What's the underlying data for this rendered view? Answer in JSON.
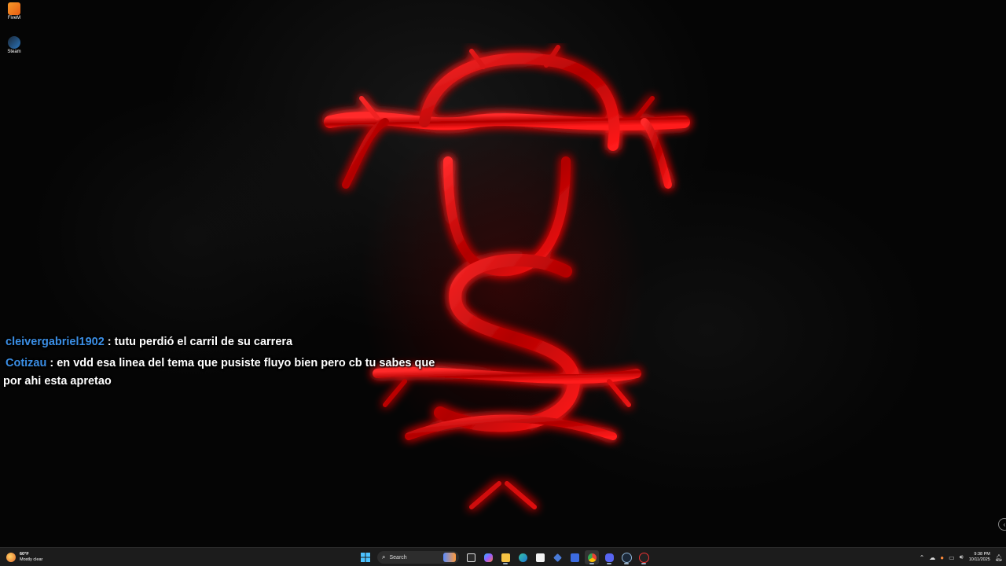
{
  "desktop": {
    "icons": [
      {
        "label": "FiveM",
        "icon": "fivem-icon"
      },
      {
        "label": "Steam",
        "icon": "steam-icon"
      }
    ],
    "wallpaper": {
      "icon": "gothic-monogram-logo",
      "glow_color": "#d10000"
    }
  },
  "chat": {
    "user_color": "#3b8fe6",
    "messages": [
      {
        "user": "cleivergabriel1902",
        "text": " : tutu perdió el carril de su carrera"
      },
      {
        "user": "Cotizau",
        "text": " : en vdd esa linea del tema que pusiste fluyo bien pero cb tu sabes que por ahi esta apretao"
      }
    ]
  },
  "taskbar": {
    "weather": {
      "temp": "60°F",
      "condition": "Mostly clear",
      "icon": "sun-moon-icon"
    },
    "search_placeholder": "Search",
    "apps": [
      "start-icon",
      "search",
      "task-view-icon",
      "copilot-icon",
      "file-explorer-icon",
      "edge-icon",
      "store-icon",
      "vpn-icon",
      "app-icon",
      "chrome-icon",
      "discord-icon",
      "steam-icon",
      "obs-icon"
    ],
    "tray": {
      "icons": [
        "chevron-up-icon",
        "onedrive-icon",
        "mic-icon",
        "display-icon",
        "volume-icon"
      ],
      "time": "9:38 PM",
      "date": "10/11/2025"
    }
  }
}
